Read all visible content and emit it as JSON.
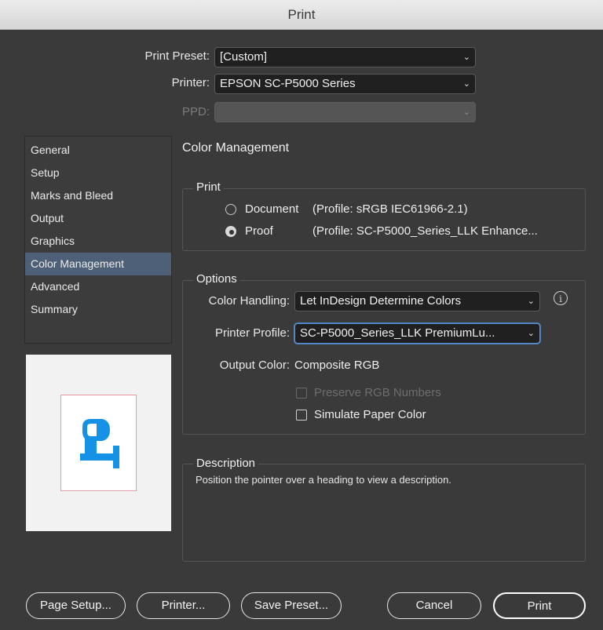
{
  "window": {
    "title": "Print"
  },
  "header": {
    "preset_label": "Print Preset:",
    "preset_value": "[Custom]",
    "printer_label": "Printer:",
    "printer_value": "EPSON SC-P5000 Series",
    "ppd_label": "PPD:",
    "ppd_value": ""
  },
  "sidebar": {
    "items": [
      {
        "label": "General"
      },
      {
        "label": "Setup"
      },
      {
        "label": "Marks and Bleed"
      },
      {
        "label": "Output"
      },
      {
        "label": "Graphics"
      },
      {
        "label": "Color Management",
        "selected": true
      },
      {
        "label": "Advanced"
      },
      {
        "label": "Summary"
      }
    ]
  },
  "preview": {
    "letter": "P",
    "letter_color": "#1592e6"
  },
  "main": {
    "section_title": "Color Management",
    "print_group": {
      "label": "Print",
      "document_label": "Document",
      "document_profile": "(Profile: sRGB IEC61966-2.1)",
      "proof_label": "Proof",
      "proof_profile": "(Profile: SC-P5000_Series_LLK Enhance...",
      "selected": "Proof"
    },
    "options_group": {
      "label": "Options",
      "color_handling_label": "Color Handling:",
      "color_handling_value": "Let InDesign Determine Colors",
      "printer_profile_label": "Printer Profile:",
      "printer_profile_value": "SC-P5000_Series_LLK PremiumLu...",
      "output_color_label": "Output Color:",
      "output_color_value": "Composite RGB",
      "preserve_rgb_label": "Preserve RGB Numbers",
      "preserve_rgb_checked": false,
      "simulate_paper_label": "Simulate Paper Color",
      "simulate_paper_checked": false
    },
    "description": {
      "label": "Description",
      "text": "Position the pointer over a heading to view a description."
    }
  },
  "footer": {
    "page_setup": "Page Setup...",
    "printer": "Printer...",
    "save_preset": "Save Preset...",
    "cancel": "Cancel",
    "print": "Print"
  },
  "colors": {
    "selection": "#4e6077",
    "focus": "#5a8fd0",
    "accent": "#1592e6"
  }
}
